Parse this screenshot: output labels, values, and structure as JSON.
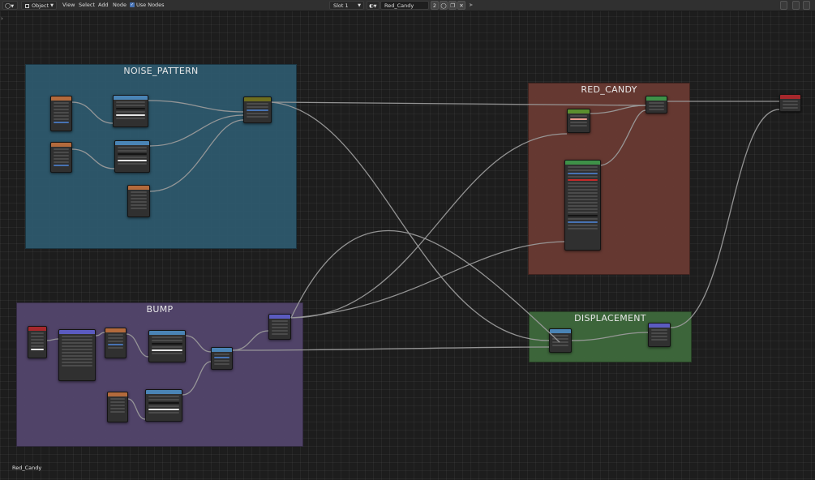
{
  "header": {
    "editor_type_icon": "node-editor-icon",
    "object_menu": "Object",
    "menus": [
      "View",
      "Select",
      "Add",
      "Node"
    ],
    "use_nodes_label": "Use Nodes",
    "use_nodes_checked": true,
    "slot": "Slot 1",
    "material_name": "Red_Candy",
    "user_count": "2"
  },
  "frames": [
    {
      "name": "noise-pattern",
      "label": "NOISE_PATTERN",
      "color": "#2e5a6f"
    },
    {
      "name": "red-candy",
      "label": "RED_CANDY",
      "color": "#6b3a33"
    },
    {
      "name": "bump",
      "label": "BUMP",
      "color": "#54466e"
    },
    {
      "name": "displacement",
      "label": "DISPLACEMENT",
      "color": "#3e6a3c"
    }
  ],
  "header_colors": {
    "input": "#b36a3c",
    "texture": "#4a84b5",
    "converter": "#5b8f2f",
    "shader": "#3e9148",
    "vector": "#5b5bc0",
    "output": "#a6282c",
    "color": "#6e6e1f"
  },
  "status": {
    "text": "Red_Candy"
  }
}
